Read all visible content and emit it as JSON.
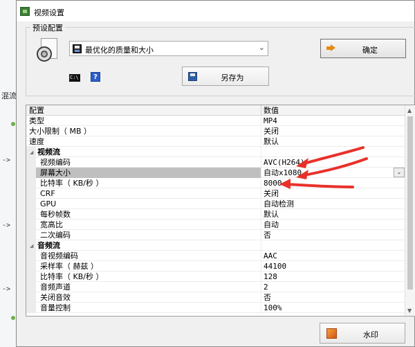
{
  "background": {
    "label": "混流",
    "arrows": [
      "->",
      "->",
      "->"
    ]
  },
  "window": {
    "title": "视频设置"
  },
  "preset": {
    "group_label": "预设配置",
    "selected": "最优化的质量和大小",
    "confirm_label": "确定",
    "cmd_icon_text": "C:\\",
    "help_icon_text": "?",
    "save_as_label": "另存为"
  },
  "grid": {
    "header": {
      "name": "配置",
      "value": "数值"
    },
    "rows": [
      {
        "type": "top",
        "name": "类型",
        "value": "MP4"
      },
      {
        "type": "top",
        "name": "大小限制（ MB ）",
        "value": "关闭"
      },
      {
        "type": "top",
        "name": "速度",
        "value": "默认"
      },
      {
        "type": "category",
        "name": "视频流",
        "value": ""
      },
      {
        "type": "item",
        "name": "视频编码",
        "value": "AVC(H264)"
      },
      {
        "type": "item",
        "name": "屏幕大小",
        "value": "自动x1080",
        "selected": true
      },
      {
        "type": "item",
        "name": "比特率（ KB/秒 ）",
        "value": "8000"
      },
      {
        "type": "item",
        "name": "CRF",
        "value": "关闭"
      },
      {
        "type": "item",
        "name": "GPU",
        "value": "自动检测"
      },
      {
        "type": "item",
        "name": "每秒帧数",
        "value": "默认"
      },
      {
        "type": "item",
        "name": "宽高比",
        "value": "自动"
      },
      {
        "type": "item",
        "name": "二次编码",
        "value": "否"
      },
      {
        "type": "category",
        "name": "音频流",
        "value": ""
      },
      {
        "type": "item",
        "name": "音视频编码",
        "value": "AAC"
      },
      {
        "type": "item",
        "name": "采样率（ 赫兹 ）",
        "value": "44100"
      },
      {
        "type": "item",
        "name": "比特率（ KB/秒 ）",
        "value": "128"
      },
      {
        "type": "item",
        "name": "音频声道",
        "value": "2"
      },
      {
        "type": "item",
        "name": "关闭音效",
        "value": "否"
      },
      {
        "type": "item",
        "name": "音量控制",
        "value": "100%"
      }
    ]
  },
  "watermark_label": "水印",
  "colors": {
    "annotation_arrow": "#e8312a",
    "selected_row": "#bfbfbf"
  }
}
